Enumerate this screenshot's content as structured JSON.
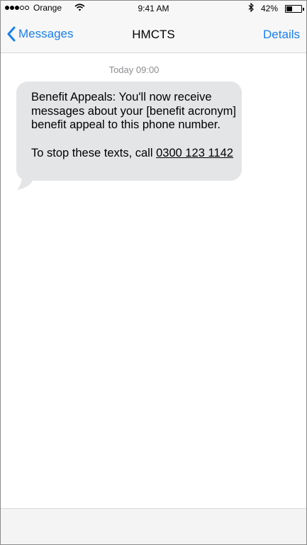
{
  "status_bar": {
    "carrier": "Orange",
    "signal_bars_filled": 3,
    "signal_bars_total": 5,
    "time": "9:41 AM",
    "battery_percent": "42%",
    "battery_level": 0.42,
    "icons": [
      "wifi-icon",
      "bluetooth-icon",
      "battery-icon"
    ]
  },
  "nav": {
    "back_label": "Messages",
    "title": "HMCTS",
    "details_label": "Details"
  },
  "conversation": {
    "timestamp": "Today 09:00",
    "messages": [
      {
        "line1": "Benefit Appeals:  You'll now receive messages about your [benefit acronym] benefit appeal to this phone number.",
        "line2_prefix": "To stop these texts, call ",
        "phone_number": "0300 123 1142"
      }
    ]
  },
  "colors": {
    "accent": "#1a7ff0",
    "bubble": "#e4e5e7",
    "timestamp": "#8e8e93",
    "bar_background": "#f7f7f7"
  }
}
